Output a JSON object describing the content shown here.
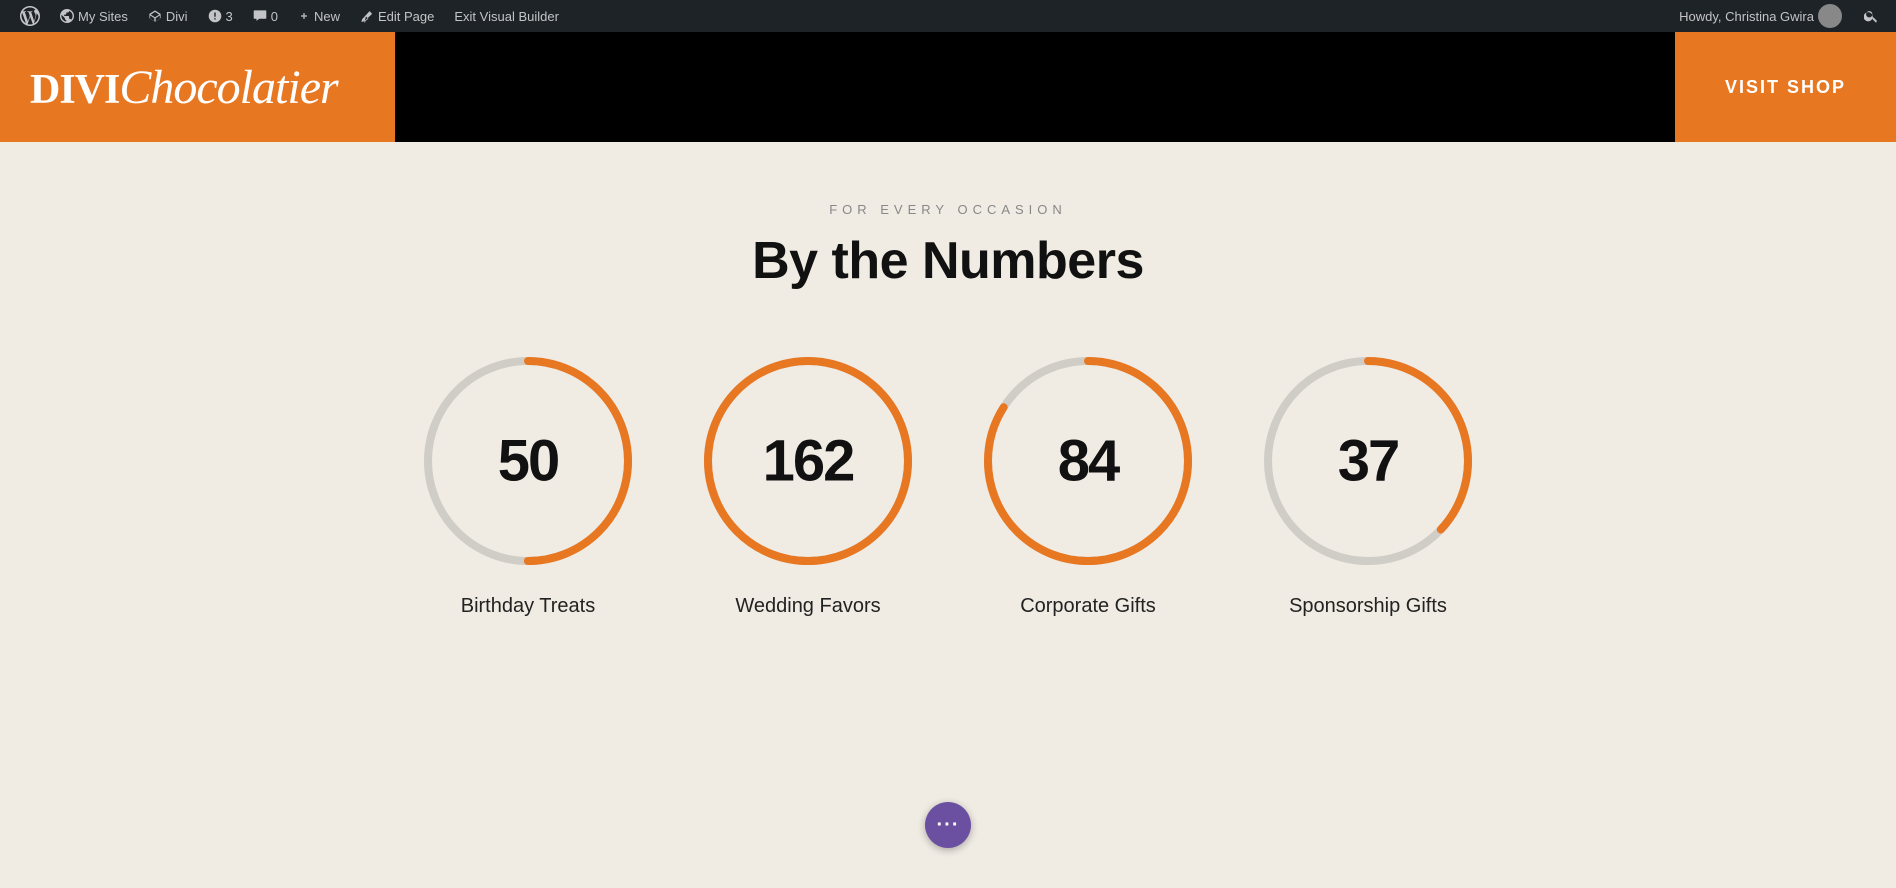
{
  "adminBar": {
    "wpIcon": "wordpress-icon",
    "mySites": "My Sites",
    "divi": "Divi",
    "updates": "3",
    "comments": "0",
    "new": "New",
    "editPage": "Edit Page",
    "exitVisualBuilder": "Exit Visual Builder",
    "howdy": "Howdy, Christina Gwira",
    "searchPlaceholder": "Search"
  },
  "header": {
    "logoMain": "DIVI",
    "logoScript": "Chocolatier",
    "visitShop": "VISIT SHOP"
  },
  "section": {
    "subtitle": "FOR EVERY OCCASION",
    "title": "By the Numbers"
  },
  "stats": [
    {
      "value": "50",
      "label": "Birthday Treats",
      "progress": 50,
      "max": 100,
      "circumference": 659.73,
      "dasharray": 329.87
    },
    {
      "value": "162",
      "label": "Wedding Favors",
      "progress": 100,
      "max": 100,
      "circumference": 659.73,
      "dasharray": 659.73
    },
    {
      "value": "84",
      "label": "Corporate Gifts",
      "progress": 84,
      "max": 100,
      "circumference": 659.73,
      "dasharray": 554.17
    },
    {
      "value": "37",
      "label": "Sponsorship Gifts",
      "progress": 37,
      "max": 100,
      "circumference": 659.73,
      "dasharray": 244.1
    }
  ],
  "floatingBtn": {
    "label": "···"
  },
  "colors": {
    "orange": "#e87722",
    "purple": "#6b4fa0",
    "trackGray": "#d0ccc6",
    "adminBg": "#1d2327"
  }
}
